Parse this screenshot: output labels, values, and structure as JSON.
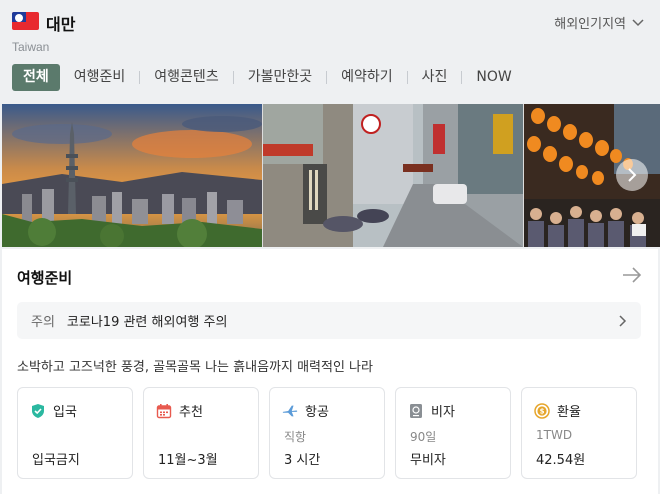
{
  "header": {
    "country": "대만",
    "country_en": "Taiwan",
    "popular_regions": "해외인기지역"
  },
  "tabs": [
    {
      "label": "전체",
      "active": true
    },
    {
      "label": "여행준비"
    },
    {
      "label": "여행콘텐츠"
    },
    {
      "label": "가볼만한곳"
    },
    {
      "label": "예약하기"
    },
    {
      "label": "사진"
    },
    {
      "label": "NOW"
    }
  ],
  "gallery": {
    "photos": [
      "taipei-101-skyline",
      "taipei-street",
      "night-market-lanterns"
    ],
    "next_icon": "chevron-right-icon"
  },
  "travel_prep": {
    "title": "여행준비",
    "notice": {
      "tag": "주의",
      "text": "코로나19 관련 해외여행 주의"
    },
    "description": "소박하고 고즈넉한 풍경, 골목골목 나는 흙내음까지 매력적인 나라",
    "cards": [
      {
        "icon": "shield-check-icon",
        "label": "입국",
        "sub": "",
        "value": "입국금지"
      },
      {
        "icon": "calendar-icon",
        "label": "추천",
        "sub": "",
        "value": "11월~3월"
      },
      {
        "icon": "airplane-icon",
        "label": "항공",
        "sub": "직항",
        "value": "3 시간"
      },
      {
        "icon": "passport-icon",
        "label": "비자",
        "sub": "90일",
        "value": "무비자"
      },
      {
        "icon": "currency-exchange-icon",
        "label": "환율",
        "sub": "1TWD",
        "value": "42.54원"
      }
    ]
  },
  "colors": {
    "tab_active_bg": "#5b7a6c",
    "shield": "#2bb8a0",
    "calendar": "#e85a4f",
    "airplane": "#5b9bd8",
    "passport": "#8a8f94",
    "currency": "#e6a52a"
  }
}
